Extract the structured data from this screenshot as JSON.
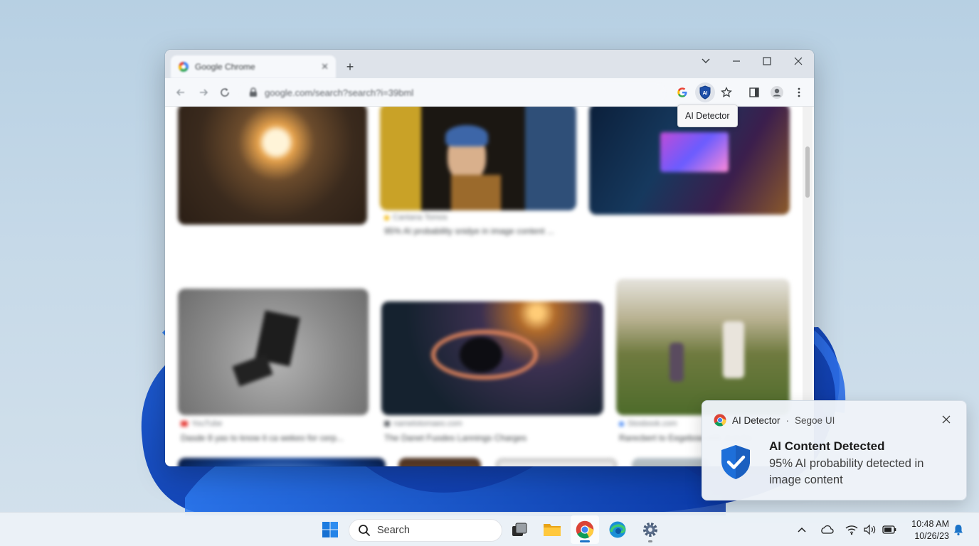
{
  "browser": {
    "tab_title": "Google Chrome",
    "new_tab_symbol": "+",
    "address": "google.com/search?search?i=39bml",
    "extension_tooltip": "AI Detector",
    "extension_badge": "AI"
  },
  "results": [
    {
      "source": "",
      "title": ""
    },
    {
      "source": "Cantana Tomos",
      "title": "95% AI probability snidye in image content ..."
    },
    {
      "source": "",
      "title": ""
    },
    {
      "source": "YouTube",
      "title": "Dasde 8 yas to know it ca wekeo for cerp..."
    },
    {
      "source": "namelotomaeo.com",
      "title": "The Danet Fuodes Lannings Charges"
    },
    {
      "source": "Stosbook.com",
      "title": "Rarecbert to Eegebow with Just for..."
    }
  ],
  "notification": {
    "app_name": "AI Detector",
    "separator": "·",
    "subtitle": "Segoe UI",
    "title": "AI Content Detected",
    "body": "95% AI probability detected in image content"
  },
  "taskbar": {
    "search_placeholder": "Search",
    "time": "10:48 AM",
    "date": "10/26/23"
  },
  "colors": {
    "accent": "#1a73c8",
    "shield": "#1e6fd9"
  }
}
